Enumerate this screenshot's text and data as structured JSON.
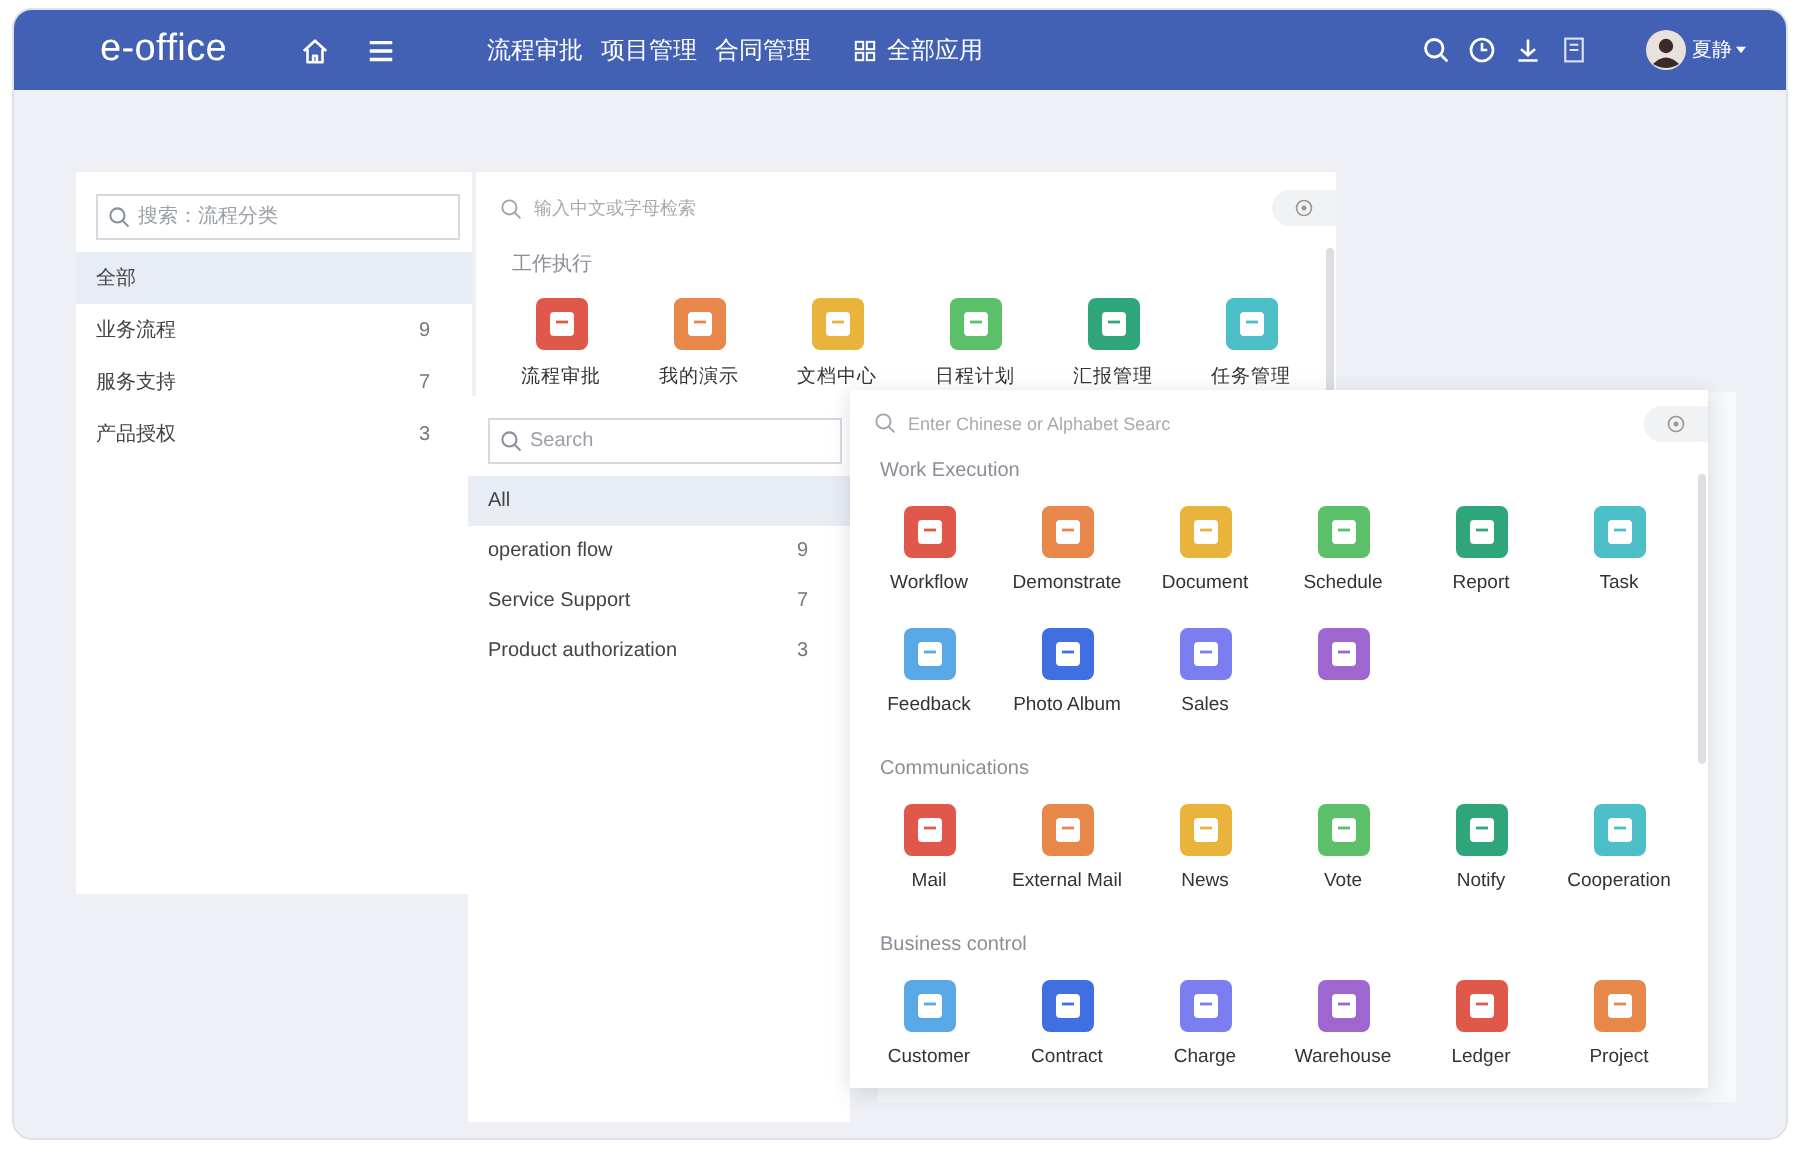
{
  "header": {
    "logo": "e-office",
    "nav": [
      "流程审批",
      "项目管理",
      "合同管理"
    ],
    "all_apps": "全部应用",
    "user": "夏静"
  },
  "windows": [
    {
      "kind": "category_list",
      "search_placeholder": "搜索：流程分类",
      "items": [
        {
          "label": "全部",
          "selected": true
        },
        {
          "label": "业务流程",
          "count": "9",
          "selected": false
        },
        {
          "label": "服务支持",
          "count": "7",
          "selected": false
        },
        {
          "label": "产品授权",
          "count": "3",
          "selected": false
        }
      ]
    },
    {
      "kind": "app_grid",
      "search_placeholder": "输入中文或字母检索",
      "sections": [
        {
          "title": "工作执行",
          "apps": [
            {
              "label": "流程审批",
              "color": "#e0584a"
            },
            {
              "label": "我的演示",
              "color": "#e8874a"
            },
            {
              "label": "文档中心",
              "color": "#eab43c"
            },
            {
              "label": "日程计划",
              "color": "#5cc06a"
            },
            {
              "label": "汇报管理",
              "color": "#2fa57a"
            },
            {
              "label": "任务管理",
              "color": "#4dbfc9"
            }
          ]
        }
      ]
    },
    {
      "kind": "category_list",
      "search_placeholder": "Search",
      "items": [
        {
          "label": "All",
          "selected": true
        },
        {
          "label": "operation flow",
          "count": "9",
          "selected": false
        },
        {
          "label": "Service Support",
          "count": "7",
          "selected": false
        },
        {
          "label": "Product authorization",
          "count": "3",
          "selected": false
        }
      ]
    },
    {
      "kind": "backdrop"
    },
    {
      "kind": "app_grid",
      "search_placeholder": "Enter Chinese or Alphabet Searc",
      "sections": [
        {
          "title": "Work Execution",
          "apps": [
            {
              "label": "Workflow",
              "color": "#e0584a"
            },
            {
              "label": "Demonstrate",
              "color": "#e8874a"
            },
            {
              "label": "Document",
              "color": "#eab43c"
            },
            {
              "label": "Schedule",
              "color": "#5cc06a"
            },
            {
              "label": "Report",
              "color": "#2fa57a"
            },
            {
              "label": "Task",
              "color": "#4dbfc9"
            },
            {
              "label": "Feedback",
              "color": "#5aa9e6"
            },
            {
              "label": "Photo Album",
              "color": "#3f6fe0"
            },
            {
              "label": "Sales",
              "color": "#7a7ef0"
            },
            {
              "color": "#a066d0"
            }
          ]
        },
        {
          "title": "Communications",
          "apps": [
            {
              "label": "Mail",
              "color": "#e0584a"
            },
            {
              "label": "External Mail",
              "color": "#e8874a"
            },
            {
              "label": "News",
              "color": "#eab43c"
            },
            {
              "label": "Vote",
              "color": "#5cc06a"
            },
            {
              "label": "Notify",
              "color": "#2fa57a"
            },
            {
              "label": "Cooperation",
              "color": "#4dbfc9"
            }
          ]
        },
        {
          "title": "Business control",
          "apps": [
            {
              "label": "Customer",
              "color": "#5aa9e6"
            },
            {
              "label": "Contract",
              "color": "#3f6fe0"
            },
            {
              "label": "Charge",
              "color": "#7a7ef0"
            },
            {
              "label": "Warehouse",
              "color": "#a066d0"
            },
            {
              "label": "Ledger",
              "color": "#e0584a"
            },
            {
              "label": "Project",
              "color": "#e8874a"
            }
          ]
        }
      ]
    }
  ]
}
